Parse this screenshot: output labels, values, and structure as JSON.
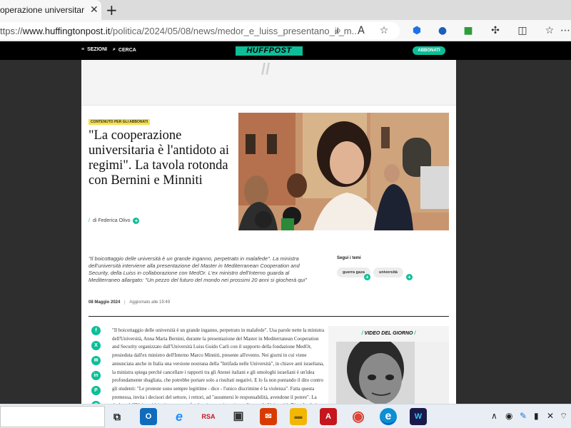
{
  "browser": {
    "tab_title": "operazione universitaria è l",
    "new_tab_label": "+",
    "url_scheme": "ttps://",
    "url_host": "www.huffingtonpost.it",
    "url_path": "/politica/2024/05/08/news/medor_e_luiss_presentano_il_m...",
    "toolbar_icons": [
      "zoom-icon",
      "read-aloud-icon",
      "favorite-star-icon",
      "extension-blue-icon",
      "extension-drop-icon",
      "extension-green-icon",
      "extensions-puzzle-icon",
      "split-screen-icon",
      "favorites-icon",
      "more-icon"
    ]
  },
  "site": {
    "menu_label": "SEZIONI",
    "search_label": "CERCA",
    "logo_text": "HUFFPOST",
    "subscribe_label": "ABBONATI",
    "ad_mark": "//",
    "brand_color": "#0dbe98"
  },
  "article": {
    "tag": "CONTENUTO PER GLI ABBONATI",
    "headline": "\"La cooperazione universitaria è l'antidoto ai regimi\". La tavola rotonda con Bernini e Minniti",
    "byline": "di Federica Olivo",
    "standfirst": "\"Il boicottaggio delle università è un grande inganno, perpetrato in malafede\". La ministra dell'università interviene alla presentazione del Master in Mediterranean Cooperation and Security, della Luiss in collaborazione con MedOr. L'ex ministro dell'Interno guarda al Mediterraneo allargato: \"Un pezzo del futuro del mondo nei prossimi 20 anni si giocherà qui\"",
    "date": "08 Maggio 2024",
    "updated": "Aggiornato alle 19:49",
    "topics_title": "Segui i temi",
    "topics": [
      "guerra gaza",
      "università"
    ],
    "body": "\"Il boicottaggio delle università è un grande inganno, perpetrato in malafede\". Usa parole nette la ministra dell'Università, Anna Maria Bernini, durante la presentazione del Master in Mediterranean Cooperation and Security organizzato dall'Università Luiss Guido Carli con il supporto della fondazione MedOr, presieduta dall'ex ministro dell'Interno Marco Minniti, presente all'evento. Nei giorni in cui viene annunciata anche in Italia una versione nostrana della \"Intifada nelle Università\", in chiave anti israeliana, la ministra spiega perché cancellare i rapporti tra gli Atenei italiani e gli omologhi israeliani è un'idea profondamente sbagliata, che potrebbe portare solo a risultati negativi. E lo fa non puntando il dito contro gli studenti: \"Le proteste sono sempre legittime - dice - l'unico discrimine è la violenza\". Fatta questa premessa, invita i decisori del settore, i rettori, ad \"assumersi le responsabilità, avendone il potere\". La titolare dell'Università invita a non confondere i governi con i popoli e con le Università. Ricordando i suoi colleghi che",
    "share_icons": [
      "facebook-icon",
      "x-icon",
      "email-icon",
      "linkedin-icon",
      "pinterest-icon",
      "whatsapp-icon"
    ],
    "share_glyphs": [
      "f",
      "X",
      "✉",
      "in",
      "P",
      "✆"
    ]
  },
  "video": {
    "title": "VIDEO DEL GIORNO"
  },
  "taskbar": {
    "apps": [
      {
        "name": "task-view-icon",
        "glyph": "⧉",
        "color": "transparent"
      },
      {
        "name": "outlook-icon",
        "glyph": "O",
        "color": "#0f6cbd"
      },
      {
        "name": "internet-explorer-icon",
        "glyph": "e",
        "color": "#1e90ff"
      },
      {
        "name": "rsa-icon",
        "glyph": "RSA",
        "color": "#e8eef4"
      },
      {
        "name": "app-monitor-icon",
        "glyph": "▣",
        "color": "#333333"
      },
      {
        "name": "app-red-icon",
        "glyph": "✉",
        "color": "#d83b01"
      },
      {
        "name": "file-explorer-icon",
        "glyph": "▬",
        "color": "#f2b705"
      },
      {
        "name": "acrobat-icon",
        "glyph": "A",
        "color": "#c4161c"
      },
      {
        "name": "chrome-icon",
        "glyph": "◉",
        "color": "#e8eef4"
      },
      {
        "name": "edge-icon",
        "glyph": "e",
        "color": "#0c8fd4"
      },
      {
        "name": "webex-icon",
        "glyph": "W",
        "color": "#1a1a4a"
      }
    ],
    "tray": [
      "chevron-up-icon",
      "record-icon",
      "pen-icon",
      "device-icon",
      "mute-icon",
      "wifi-icon"
    ]
  }
}
